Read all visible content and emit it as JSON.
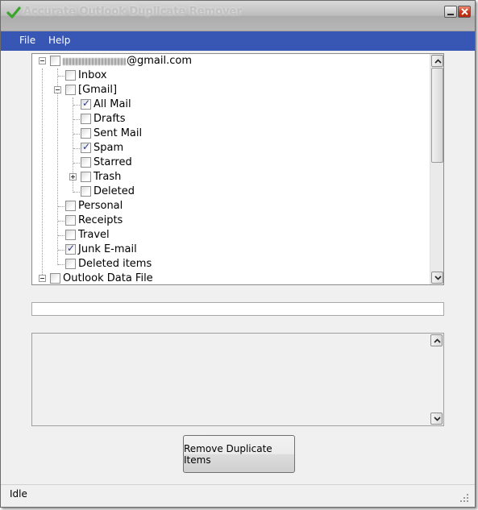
{
  "window": {
    "title": "Accurate Outlook Duplicate Remover",
    "accent_color": "#3856b3"
  },
  "menu": {
    "items": [
      {
        "label": "File"
      },
      {
        "label": "Help"
      }
    ]
  },
  "tree": {
    "account_domain": "@gmail.com",
    "nodes": [
      {
        "label": "Inbox",
        "checked": false
      },
      {
        "label": "[Gmail]",
        "checked": false,
        "expanded": true
      },
      {
        "label": "All Mail",
        "checked": true
      },
      {
        "label": "Drafts",
        "checked": false
      },
      {
        "label": "Sent Mail",
        "checked": false
      },
      {
        "label": "Spam",
        "checked": true
      },
      {
        "label": "Starred",
        "checked": false
      },
      {
        "label": "Trash",
        "checked": false,
        "expanded": false
      },
      {
        "label": "Deleted",
        "checked": false
      },
      {
        "label": "Personal",
        "checked": false
      },
      {
        "label": "Receipts",
        "checked": false
      },
      {
        "label": "Travel",
        "checked": false
      },
      {
        "label": "Junk E-mail",
        "checked": true
      },
      {
        "label": "Deleted items",
        "checked": false
      },
      {
        "label": "Outlook Data File",
        "checked": false,
        "expanded": true
      }
    ]
  },
  "progress": {
    "value": 0
  },
  "log": {
    "text": ""
  },
  "action": {
    "label": "Remove Duplicate Items"
  },
  "status": {
    "text": "Idle"
  }
}
